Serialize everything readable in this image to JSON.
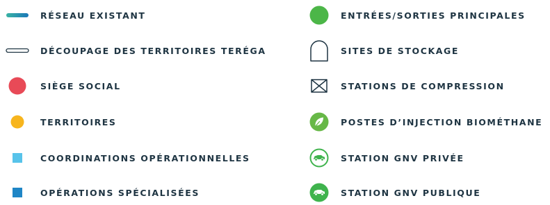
{
  "colors": {
    "text": "#1e3442",
    "siege_social": "#e84a57",
    "territoires": "#f7b51e",
    "coordinations": "#58c3ea",
    "operations": "#1f86c6",
    "entrees_sorties": "#4cb648",
    "biomethane": "#67b847",
    "gnv": "#3fb34d",
    "outline": "#1e3442",
    "reseau_gradient": [
      "#3ab3a4",
      "#1a77b8"
    ]
  },
  "legend": {
    "left": [
      {
        "label": "RÉSEAU EXISTANT",
        "icon": "gradient-line-icon"
      },
      {
        "label": "DÉCOUPAGE DES TERRITOIRES TERÉGA",
        "icon": "outlined-line-icon"
      },
      {
        "label": "SIÈGE SOCIAL",
        "icon": "red-circle-icon"
      },
      {
        "label": "TERRITOIRES",
        "icon": "yellow-circle-icon"
      },
      {
        "label": "COORDINATIONS OPÉRATIONNELLES",
        "icon": "light-blue-square-icon"
      },
      {
        "label": "OPÉRATIONS SPÉCIALISÉES",
        "icon": "blue-square-icon"
      }
    ],
    "right": [
      {
        "label": "ENTRÉES/SORTIES PRINCIPALES",
        "icon": "green-circle-icon"
      },
      {
        "label": "SITES DE STOCKAGE",
        "icon": "storage-arch-icon"
      },
      {
        "label": "STATIONS DE COMPRESSION",
        "icon": "compression-icon"
      },
      {
        "label": "POSTES D’INJECTION BIOMÉTHANE",
        "icon": "leaf-icon"
      },
      {
        "label": "STATION GNV PRIVÉE",
        "icon": "gnv-private-icon"
      },
      {
        "label": "STATION GNV PUBLIQUE",
        "icon": "gnv-public-icon"
      }
    ]
  }
}
